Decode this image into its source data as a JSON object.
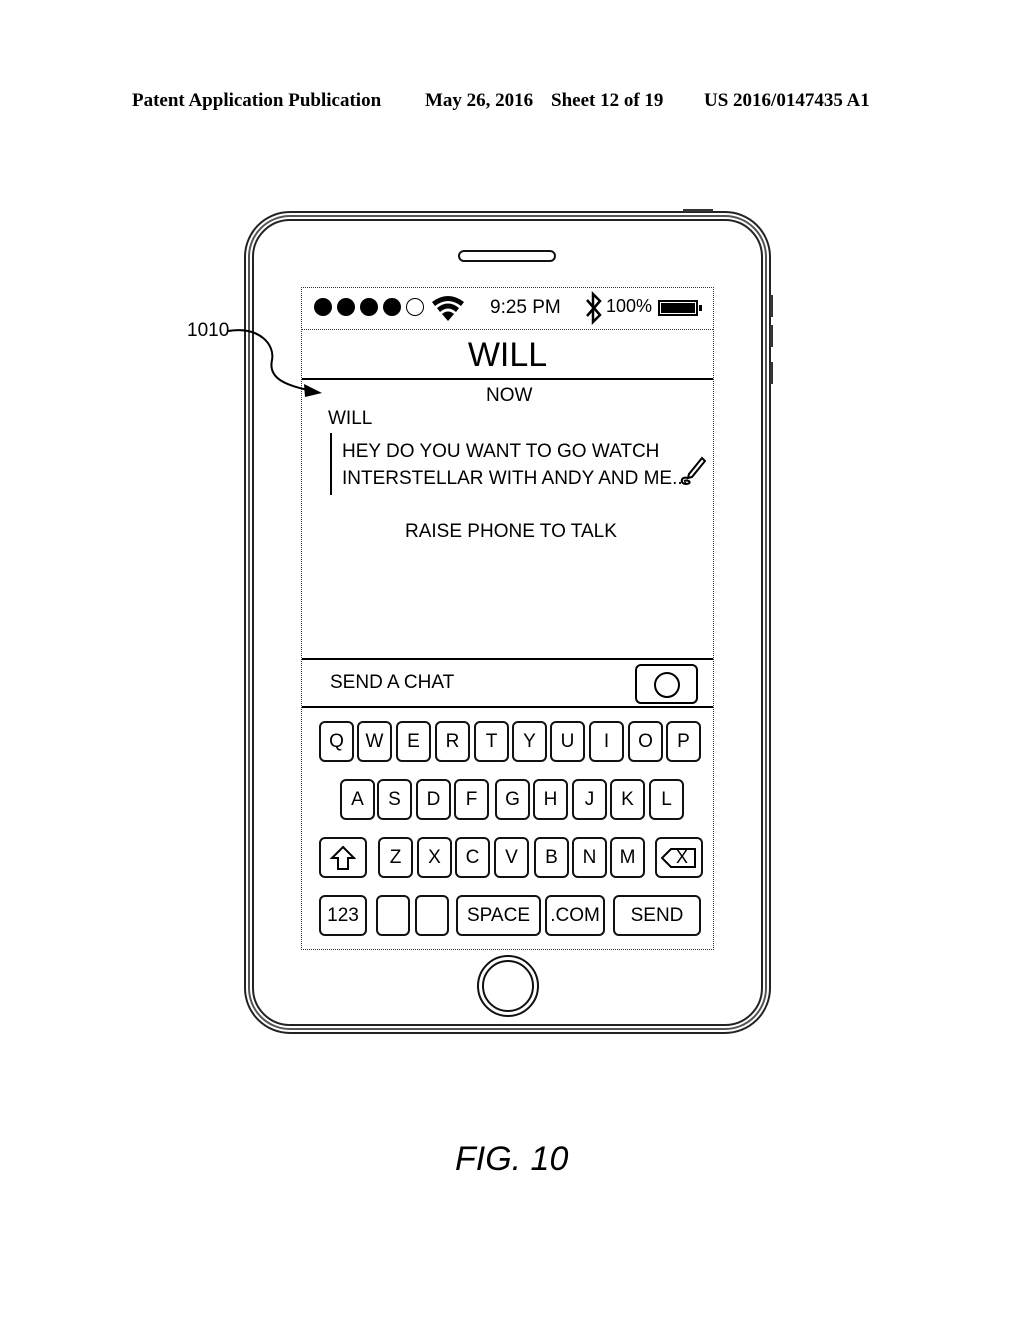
{
  "header": {
    "publication": "Patent Application Publication",
    "date": "May 26, 2016",
    "sheet": "Sheet 12 of 19",
    "number": "US 2016/0147435 A1"
  },
  "reference_label": "1010",
  "figure_label": "FIG. 10",
  "status_bar": {
    "signal_bars_filled": 4,
    "signal_bars_total": 5,
    "wifi_icon": "wifi-icon",
    "time": "9:25 PM",
    "bluetooth_icon": "bluetooth-icon",
    "battery_percent": "100%",
    "battery_level": 1.0
  },
  "chat": {
    "contact_name": "WILL",
    "timestamp": "NOW",
    "sender": "WILL",
    "message_line1": "HEY DO YOU WANT TO GO WATCH",
    "message_line2": "INTERSTELLAR WITH ANDY AND ME...",
    "edit_icon": "pencil-icon",
    "hint": "RAISE PHONE TO TALK"
  },
  "compose": {
    "placeholder": "SEND A CHAT",
    "camera_icon": "camera-shutter-icon"
  },
  "keyboard": {
    "row1": [
      "Q",
      "W",
      "E",
      "R",
      "T",
      "Y",
      "U",
      "I",
      "O",
      "P"
    ],
    "row2": [
      "A",
      "S",
      "D",
      "F",
      "G",
      "H",
      "J",
      "K",
      "L"
    ],
    "row3": [
      "Z",
      "X",
      "C",
      "V",
      "B",
      "N",
      "M"
    ],
    "shift_icon": "shift-arrow-icon",
    "backspace_icon": "backspace-icon",
    "backspace_glyph": "X",
    "numbers": "123",
    "space": "SPACE",
    "dotcom": ".COM",
    "send": "SEND"
  }
}
